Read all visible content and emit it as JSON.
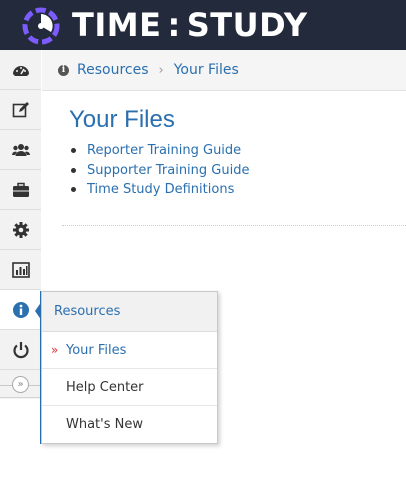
{
  "header": {
    "brand_left": "TIME",
    "brand_sep": ":",
    "brand_right": "STUDY",
    "colors": {
      "background": "#232a3b",
      "logo_accent": "#7d5cff"
    }
  },
  "sidebar": {
    "items": [
      {
        "name": "dashboard",
        "icon": "tachometer-icon"
      },
      {
        "name": "edit",
        "icon": "edit-icon"
      },
      {
        "name": "users",
        "icon": "users-icon"
      },
      {
        "name": "briefcase",
        "icon": "briefcase-icon"
      },
      {
        "name": "settings",
        "icon": "gear-icon"
      },
      {
        "name": "reports",
        "icon": "bar-chart-icon"
      },
      {
        "name": "resources",
        "icon": "info-icon",
        "active": true
      },
      {
        "name": "logout",
        "icon": "power-icon"
      }
    ],
    "collapse_glyph": "»"
  },
  "breadcrumb": {
    "items": [
      "Resources",
      "Your Files"
    ],
    "separator": "›"
  },
  "main": {
    "title": "Your Files",
    "files": [
      "Reporter Training Guide",
      "Supporter Training Guide",
      "Time Study Definitions"
    ]
  },
  "flyout": {
    "header": "Resources",
    "current_marker": "»",
    "items": [
      "Your Files",
      "Help Center",
      "What's New"
    ]
  },
  "colors": {
    "link": "#2a6fb0",
    "current_marker": "#dd3333"
  }
}
